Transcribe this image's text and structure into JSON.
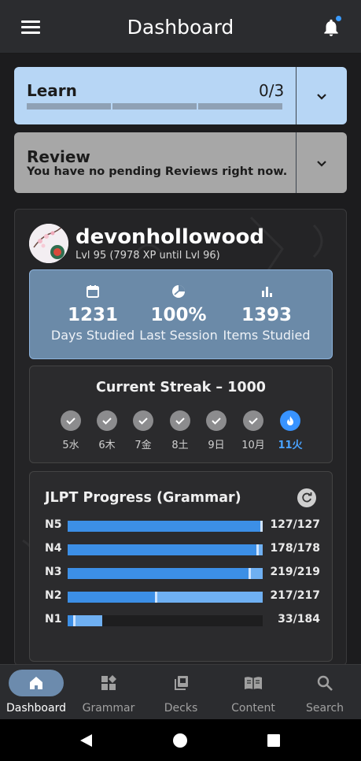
{
  "header": {
    "title": "Dashboard",
    "has_notification": true
  },
  "learn": {
    "title": "Learn",
    "count": "0/3"
  },
  "review": {
    "title": "Review",
    "subtitle": "You have no pending Reviews right now."
  },
  "profile": {
    "username": "devonhollowood",
    "level": "Lvl 95 (7978 XP until Lvl 96)"
  },
  "stats": [
    {
      "icon": "calendar-icon",
      "value": "1231",
      "label": "Days Studied"
    },
    {
      "icon": "pie-chart-icon",
      "value": "100%",
      "label": "Last Session"
    },
    {
      "icon": "bar-chart-icon",
      "value": "1393",
      "label": "Items Studied"
    }
  ],
  "streak": {
    "title": "Current Streak – 1000",
    "days": [
      {
        "label": "5水",
        "status": "done"
      },
      {
        "label": "6木",
        "status": "done"
      },
      {
        "label": "7金",
        "status": "done"
      },
      {
        "label": "8土",
        "status": "done"
      },
      {
        "label": "9日",
        "status": "done"
      },
      {
        "label": "10月",
        "status": "done"
      },
      {
        "label": "11火",
        "status": "today"
      }
    ]
  },
  "jlpt": {
    "title": "JLPT Progress (Grammar)",
    "levels": [
      {
        "level": "N5",
        "count": "127/127",
        "progress": 1.0,
        "mastered": 1.0
      },
      {
        "level": "N4",
        "count": "178/178",
        "progress": 1.0,
        "mastered": 0.98
      },
      {
        "level": "N3",
        "count": "219/219",
        "progress": 1.0,
        "mastered": 0.94
      },
      {
        "level": "N2",
        "count": "217/217",
        "progress": 1.0,
        "mastered": 0.46
      },
      {
        "level": "N1",
        "count": "33/184",
        "progress": 0.179,
        "mastered": 0.04
      }
    ]
  },
  "nav": [
    {
      "label": "Dashboard",
      "icon": "home-icon",
      "active": true
    },
    {
      "label": "Grammar",
      "icon": "grammar-icon",
      "active": false
    },
    {
      "label": "Decks",
      "icon": "decks-icon",
      "active": false
    },
    {
      "label": "Content",
      "icon": "book-icon",
      "active": false
    },
    {
      "label": "Search",
      "icon": "search-icon",
      "active": false
    }
  ],
  "colors": {
    "accent": "#3893ff",
    "learn_bg": "#b7d6f5",
    "review_bg": "#a7a7a7",
    "stats_bg": "#6b8aa8"
  }
}
